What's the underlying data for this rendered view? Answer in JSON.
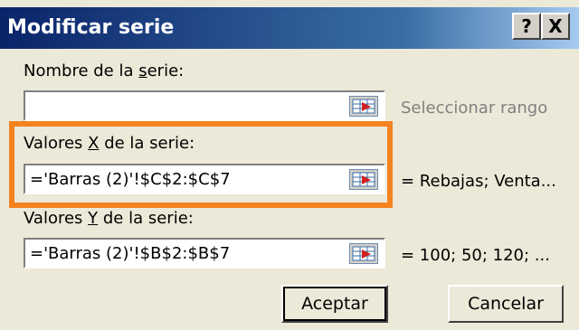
{
  "window": {
    "title": "Modificar serie",
    "help_label": "?",
    "close_label": "X"
  },
  "series_name": {
    "label_before": "Nombre de la ",
    "label_ul": "s",
    "label_after": "erie:",
    "value": "",
    "hint": "Seleccionar rango"
  },
  "x_values": {
    "label_before": "Valores ",
    "label_ul": "X",
    "label_after": " de la serie:",
    "value": "='Barras (2)'!$C$2:$C$7",
    "preview": "= Rebajas; Venta..."
  },
  "y_values": {
    "label_before": "Valores ",
    "label_ul": "Y",
    "label_after": " de la serie:",
    "value": "='Barras (2)'!$B$2:$B$7",
    "preview": "= 100; 50; 120; ..."
  },
  "buttons": {
    "accept": "Aceptar",
    "cancel": "Cancelar"
  },
  "colors": {
    "highlight": "#f58220",
    "title_bar": "#0a246a"
  }
}
